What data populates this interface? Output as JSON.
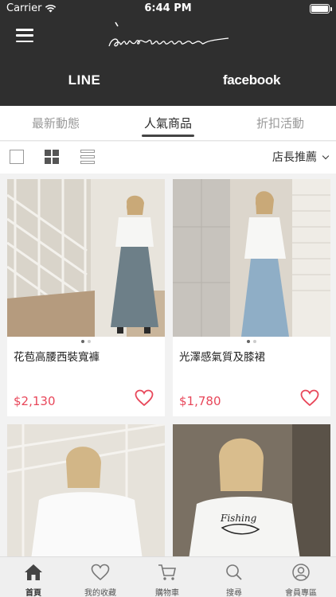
{
  "status_bar": {
    "carrier": "Carrier",
    "time": "6:44 PM",
    "battery_level": 1.0
  },
  "header": {
    "menu_icon": "hamburger-icon",
    "brand_logo_text": "aweeme",
    "social": {
      "line": "LINE",
      "facebook": "facebook"
    }
  },
  "tabs": [
    {
      "label": "最新動態",
      "active": false
    },
    {
      "label": "人氣商品",
      "active": true
    },
    {
      "label": "折扣活動",
      "active": false
    }
  ],
  "toolbar": {
    "view_modes": [
      "checkbox-icon",
      "grid-view-icon",
      "list-view-icon"
    ],
    "sort_label": "店長推薦"
  },
  "products": [
    {
      "name": "花苞高腰西裝寬褲",
      "price": "$2,130",
      "favorited": false
    },
    {
      "name": "光澤感氣質及膝裙",
      "price": "$1,780",
      "favorited": false
    },
    {
      "name": "",
      "price": "",
      "favorited": false
    },
    {
      "name": "",
      "price": "",
      "favorited": false
    }
  ],
  "bottom_nav": [
    {
      "label": "首頁",
      "icon": "home-icon",
      "active": true
    },
    {
      "label": "我的收藏",
      "icon": "heart-icon",
      "active": false
    },
    {
      "label": "購物車",
      "icon": "cart-icon",
      "active": false
    },
    {
      "label": "搜尋",
      "icon": "search-icon",
      "active": false
    },
    {
      "label": "會員專區",
      "icon": "user-icon",
      "active": false
    }
  ],
  "colors": {
    "header_bg": "#2f2f2f",
    "price": "#e8475a",
    "accent_dark": "#444444"
  }
}
